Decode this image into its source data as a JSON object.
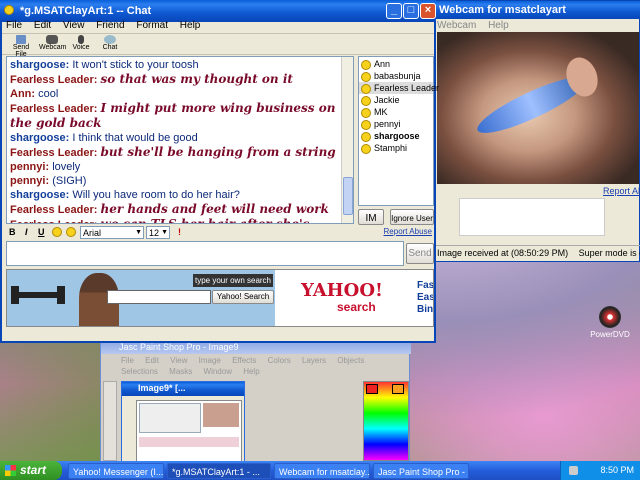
{
  "chat": {
    "title": "*g.MSATClayArt:1 -- Chat",
    "menu": [
      "File",
      "Edit",
      "View",
      "Friend",
      "Format",
      "Help"
    ],
    "toolbar": [
      "Send File",
      "Webcam",
      "Voice",
      "Chat"
    ],
    "lines": [
      {
        "nick": "shargoose:",
        "text": "It won't stick to your toosh",
        "style": "plain",
        "nickstyle": "b"
      },
      {
        "nick": "Fearless Leader:",
        "text": "so that was my thought on it",
        "style": "script",
        "nickstyle": "a"
      },
      {
        "nick": "Ann:",
        "text": "cool",
        "style": "plain",
        "nickstyle": "a"
      },
      {
        "nick": "Fearless Leader:",
        "text": "I might put more wing business on the gold back",
        "style": "script",
        "nickstyle": "a"
      },
      {
        "nick": "shargoose:",
        "text": "I think that would be good",
        "style": "plain",
        "nickstyle": "b"
      },
      {
        "nick": "Fearless Leader:",
        "text": "but she'll be hanging from a string",
        "style": "script",
        "nickstyle": "a"
      },
      {
        "nick": "pennyi:",
        "text": "lovely",
        "style": "plain",
        "nickstyle": "a"
      },
      {
        "nick": "pennyi:",
        "text": "(SIGH)",
        "style": "plain",
        "nickstyle": "a"
      },
      {
        "nick": "shargoose:",
        "text": "Will you have room to do her hair?",
        "style": "plain",
        "nickstyle": "b"
      },
      {
        "nick": "Fearless Leader:",
        "text": "her hands and feet will need work",
        "style": "script",
        "nickstyle": "a"
      },
      {
        "nick": "Fearless Leader:",
        "text": "we can TLS her hair after she's cured the first time",
        "style": "script",
        "nickstyle": "a"
      }
    ],
    "users": [
      {
        "name": "Ann",
        "bold": false
      },
      {
        "name": "babasbunja",
        "bold": false
      },
      {
        "name": "Fearless Leader",
        "bold": false
      },
      {
        "name": "Jackie",
        "bold": false
      },
      {
        "name": "MK",
        "bold": false
      },
      {
        "name": "pennyi",
        "bold": false
      },
      {
        "name": "shargoose",
        "bold": true
      },
      {
        "name": "Stamphi",
        "bold": false
      }
    ],
    "im_label": "IM",
    "ignore_label": "Ignore User",
    "format": {
      "bold": "B",
      "italic": "I",
      "underline": "U",
      "font": "Arial",
      "size": "12"
    },
    "report_abuse": "Report Abuse",
    "send_label": "Send",
    "ad": {
      "search_prompt": "type your own search",
      "search_button": "Yahoo! Search",
      "logo": "YAHOO!",
      "logo_sub": "search",
      "side_text": [
        "Fast",
        "Easi",
        "Bing"
      ]
    }
  },
  "webcam": {
    "title": "Webcam for msatclayart",
    "menu": [
      "Webcam",
      "Help"
    ],
    "report_abuse": "Report Abus",
    "status": "Image received at (08:50:29 PM)",
    "super_mode": "Super mode is off - What's this"
  },
  "desktop": {
    "icon_label": "PowerDVD"
  },
  "psp": {
    "title": "Jasc Paint Shop Pro - Image9",
    "menu": [
      "File",
      "Edit",
      "View",
      "Image",
      "Effects",
      "Colors",
      "Layers",
      "Objects",
      "Selections",
      "Masks",
      "Window",
      "Help"
    ],
    "image_title": "Image9* [..."
  },
  "taskbar": {
    "start": "start",
    "tasks": [
      "Yahoo! Messenger (I...",
      "*g.MSATClayArt:1 - ...",
      "Webcam for msatclay...",
      "Jasc Paint Shop Pro - ..."
    ],
    "clock": "8:50 PM"
  },
  "colors": {
    "xp_blue": "#0a5fd8",
    "start_green": "#3c9a2c",
    "nick_red": "#8b1515",
    "nick_blue": "#123f9a"
  }
}
